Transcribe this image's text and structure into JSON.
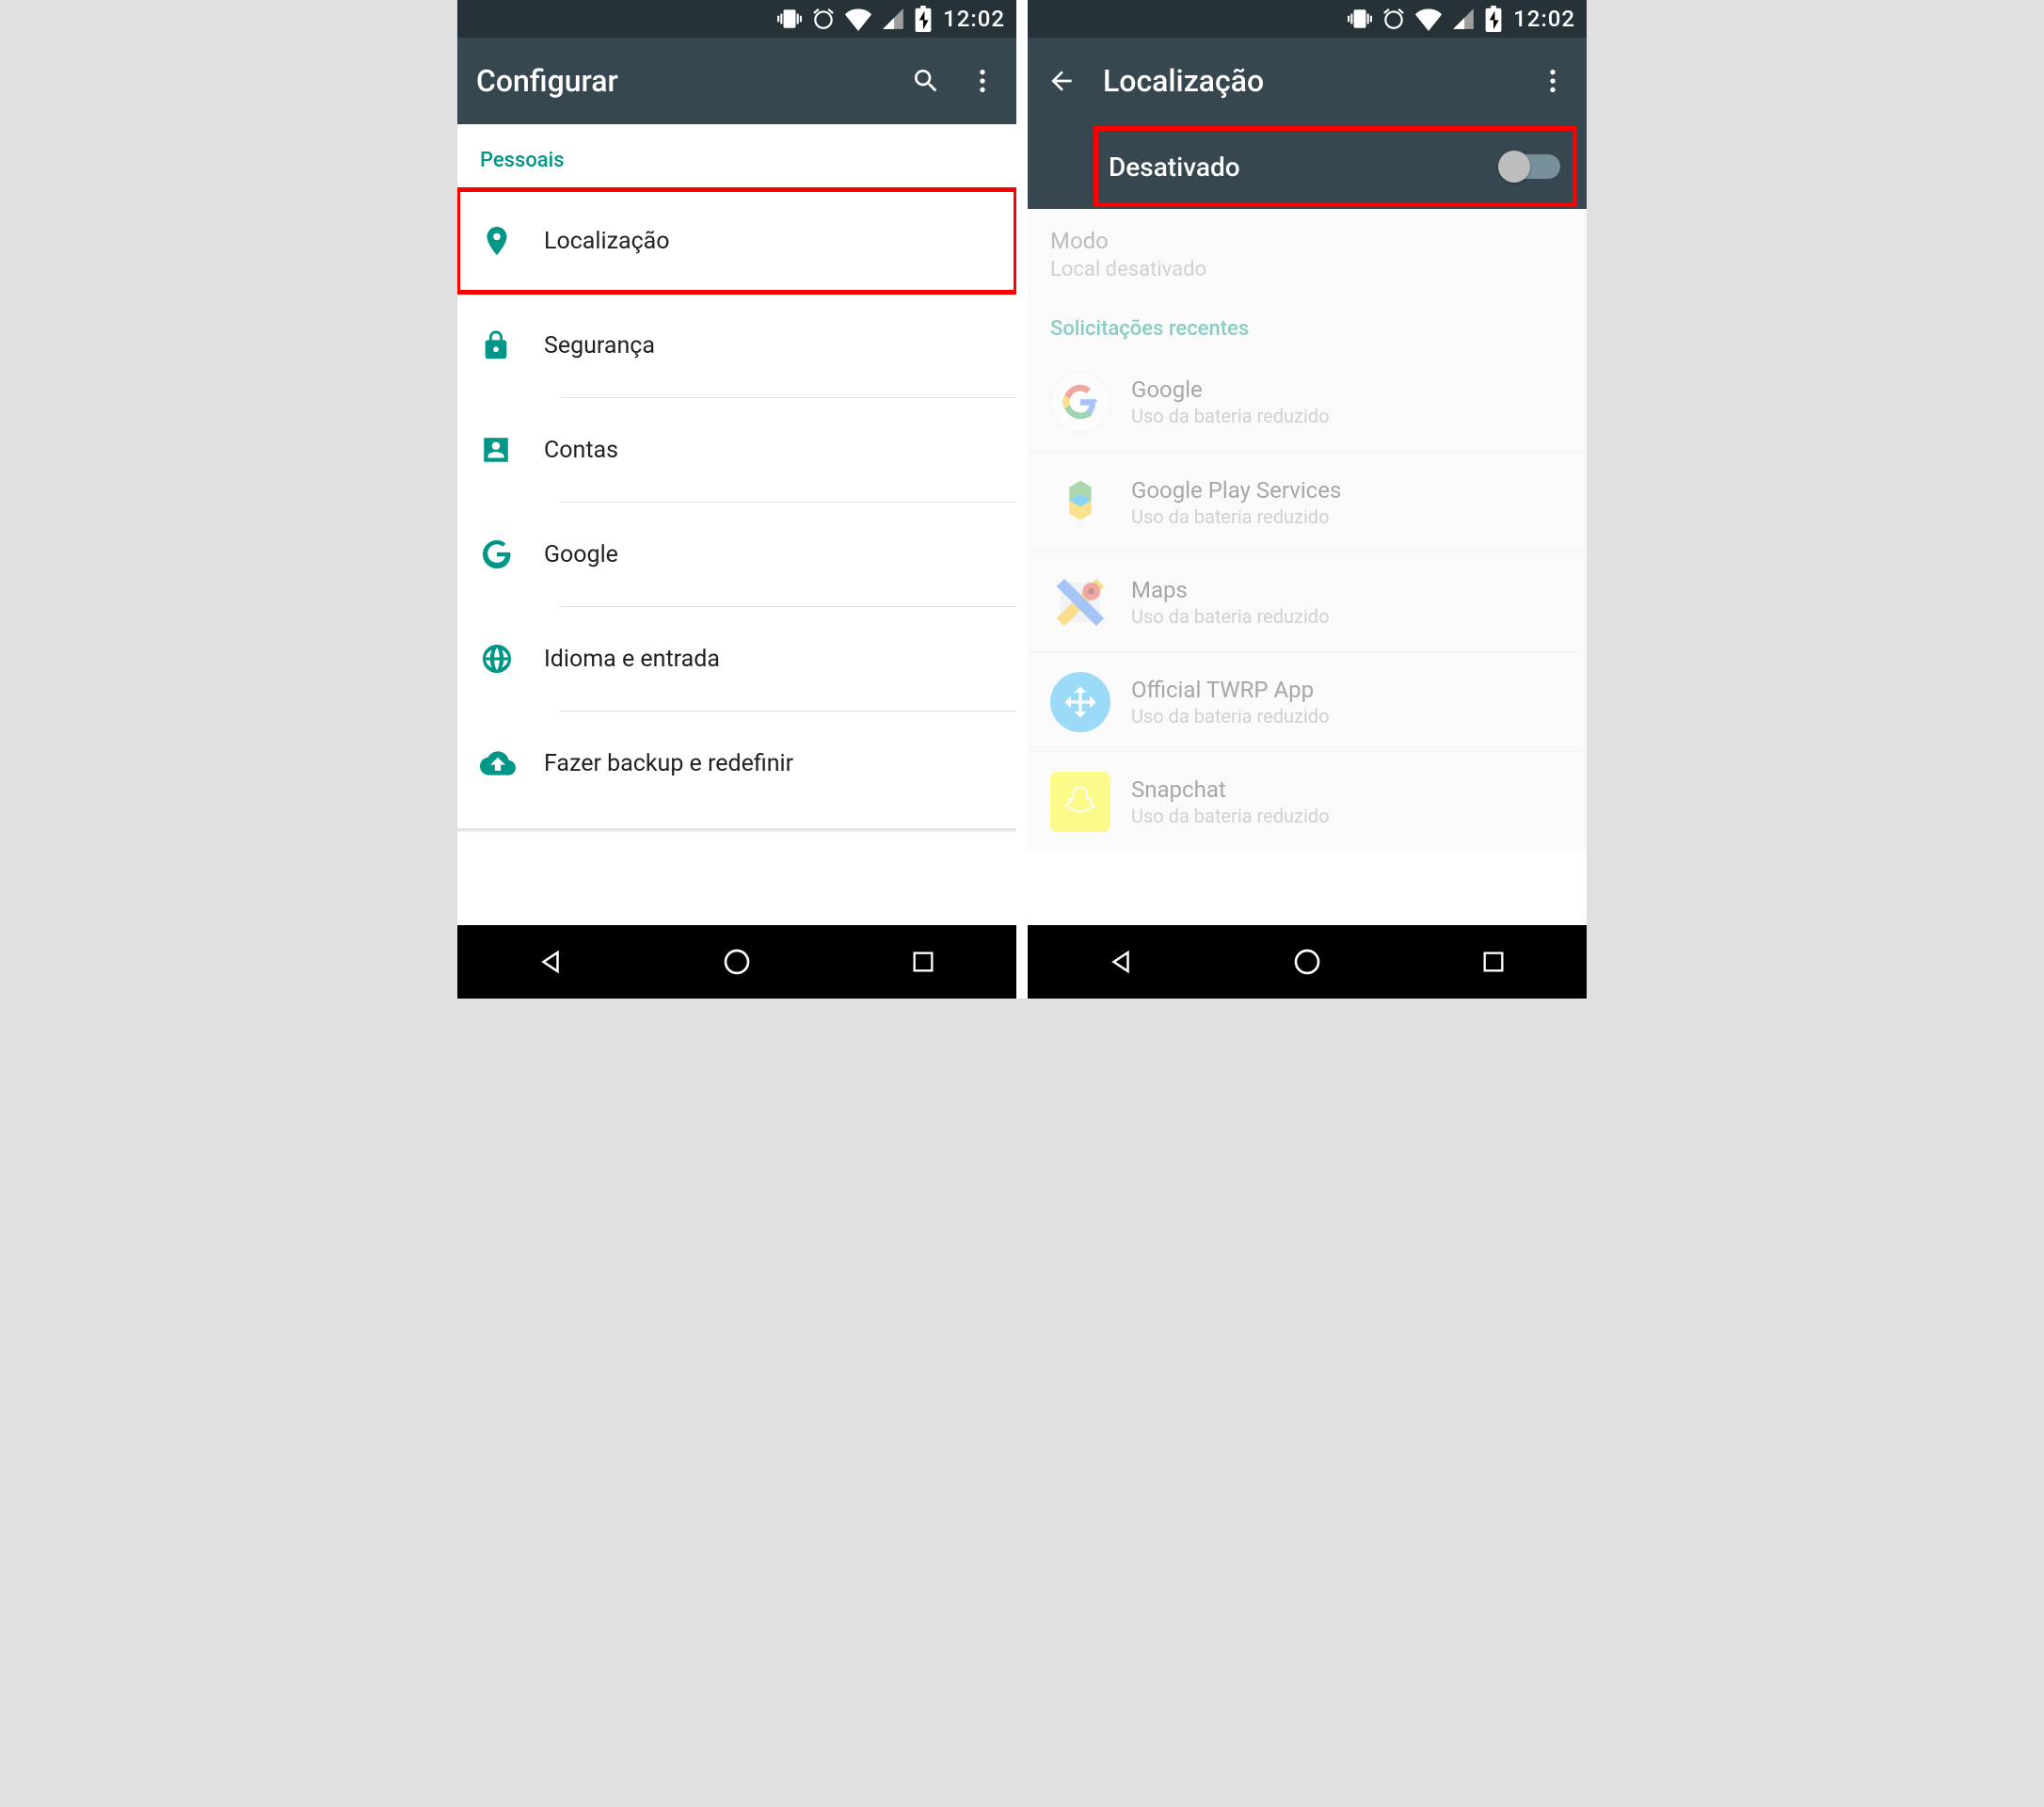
{
  "status": {
    "time": "12:02"
  },
  "left": {
    "appbar_title": "Configurar",
    "section_personal": "Pessoais",
    "items": {
      "location": "Localização",
      "security": "Segurança",
      "accounts": "Contas",
      "google": "Google",
      "language": "Idioma e entrada",
      "backup": "Fazer backup e redefinir"
    }
  },
  "right": {
    "appbar_title": "Localização",
    "toggle_label": "Desativado",
    "mode_title": "Modo",
    "mode_subtitle": "Local desativado",
    "recent_header": "Solicitações recentes",
    "battery_low": "Uso da bateria reduzido",
    "apps": {
      "google": "Google",
      "play_services": "Google Play Services",
      "maps": "Maps",
      "twrp": "Official TWRP App",
      "snapchat": "Snapchat"
    }
  }
}
